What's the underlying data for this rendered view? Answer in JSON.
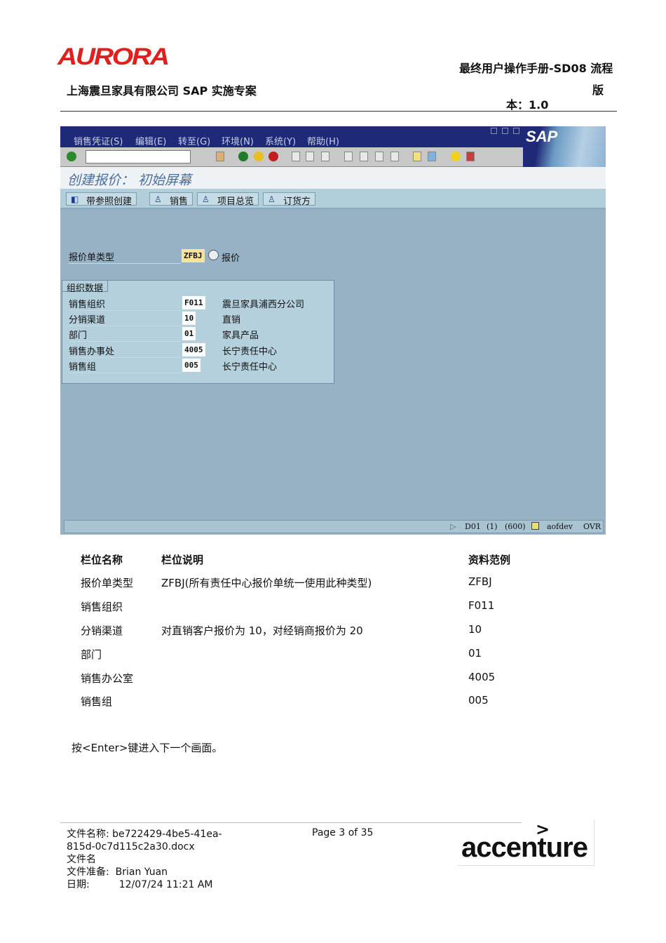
{
  "header": {
    "logo": "AURORA",
    "company": "上海震旦家具有限公司 SAP 实施专案",
    "doc_title_line1": "最终用户操作手册-SD08 流程",
    "doc_title_line2": "版",
    "version": "本：1.0"
  },
  "sap": {
    "menu": [
      "销售凭证(S)",
      "编辑(E)",
      "转至(G)",
      "环境(N)",
      "系统(Y)",
      "帮助(H)"
    ],
    "logo": "SAP",
    "screen_title": "创建报价：  初始屏幕",
    "app_buttons": [
      "带参照创建",
      "销售",
      "项目总览",
      "订货方"
    ],
    "quote_type": {
      "label": "报价单类型",
      "value": "ZFBJ",
      "desc": "报价"
    },
    "group_title": "组织数据",
    "org_fields": [
      {
        "label": "销售组织",
        "value": "F011",
        "desc": "震旦家具浦西分公司"
      },
      {
        "label": "分销渠道",
        "value": "10",
        "desc": "直销"
      },
      {
        "label": "部门",
        "value": "01",
        "desc": "家具产品"
      },
      {
        "label": "销售办事处",
        "value": "4005",
        "desc": "长宁责任中心"
      },
      {
        "label": "销售组",
        "value": "005",
        "desc": "长宁责任中心"
      }
    ],
    "status": {
      "system": "D01",
      "session": "(1)",
      "client": "(600)",
      "server": "aofdev",
      "mode": "OVR"
    }
  },
  "table": {
    "headers": [
      "栏位名称",
      "栏位说明",
      "资料范例"
    ],
    "rows": [
      [
        "报价单类型",
        "ZFBJ(所有责任中心报价单统一使用此种类型)",
        "ZFBJ"
      ],
      [
        "销售组织",
        "",
        "F011"
      ],
      [
        "分销渠道",
        "对直销客户报价为 10，对经销商报价为 20",
        "10"
      ],
      [
        "部门",
        "",
        "01"
      ],
      [
        "销售办公室",
        "",
        "4005"
      ],
      [
        "销售组",
        "",
        "005"
      ]
    ]
  },
  "instruction": "按<Enter>键进入下一个画面。",
  "footer": {
    "filename_label": "文件名称:",
    "filename": "be722429-4be5-41ea-",
    "filename2": "815d-0c7d115c2a30.docx",
    "filename_suffix": "文件名",
    "prepared_label": "文件准备:",
    "prepared": "Brian Yuan",
    "date_label": "日期:",
    "date": "12/07/24 11:21 AM",
    "page": "Page 3 of 35",
    "logo": "accenture"
  }
}
